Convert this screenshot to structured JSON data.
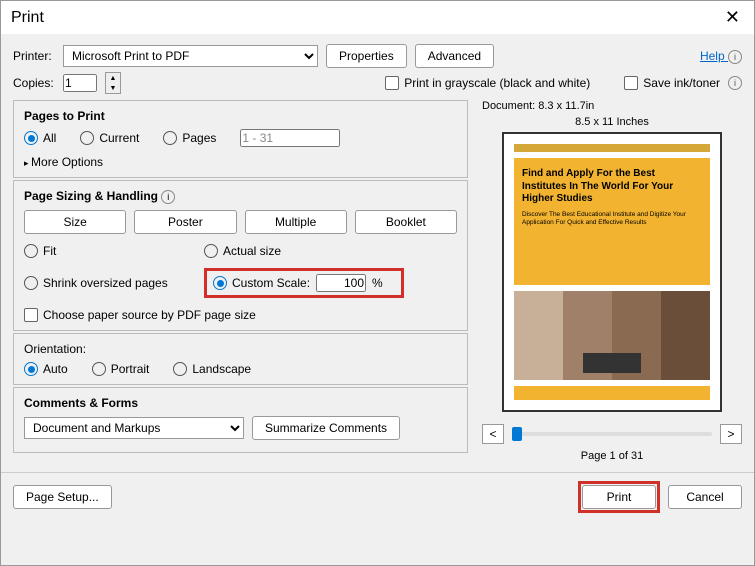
{
  "title": "Print",
  "help": "Help",
  "printer": {
    "label": "Printer:",
    "value": "Microsoft Print to PDF",
    "properties": "Properties",
    "advanced": "Advanced"
  },
  "copies": {
    "label": "Copies:",
    "value": "1"
  },
  "grayscale": "Print in grayscale (black and white)",
  "saveink": "Save ink/toner",
  "pages": {
    "title": "Pages to Print",
    "all": "All",
    "current": "Current",
    "pages": "Pages",
    "range": "1 - 31",
    "more": "More Options"
  },
  "sizing": {
    "title": "Page Sizing & Handling",
    "size": "Size",
    "poster": "Poster",
    "multiple": "Multiple",
    "booklet": "Booklet",
    "fit": "Fit",
    "actual": "Actual size",
    "shrink": "Shrink oversized pages",
    "custom": "Custom Scale:",
    "scale": "100",
    "pct": "%",
    "choose": "Choose paper source by PDF page size"
  },
  "orient": {
    "title": "Orientation:",
    "auto": "Auto",
    "portrait": "Portrait",
    "landscape": "Landscape"
  },
  "cf": {
    "title": "Comments & Forms",
    "value": "Document and Markups",
    "summarize": "Summarize Comments"
  },
  "preview": {
    "doc": "Document: 8.3 x 11.7in",
    "page": "8.5 x 11 Inches",
    "title": "Find and Apply For the Best Institutes In The World For Your Higher Studies",
    "sub": "Discover The Best Educational Institute and Digitize Your Application For Quick and Effective Results",
    "pageof": "Page 1 of 31"
  },
  "footer": {
    "setup": "Page Setup...",
    "print": "Print",
    "cancel": "Cancel"
  }
}
